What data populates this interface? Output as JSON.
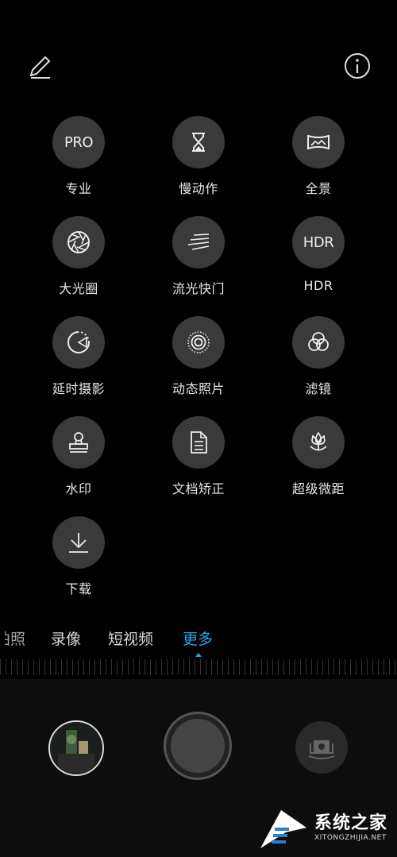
{
  "modes": [
    {
      "label": "专业",
      "icon": "pro-text-icon",
      "icon_text": "PRO"
    },
    {
      "label": "慢动作",
      "icon": "hourglass-icon"
    },
    {
      "label": "全景",
      "icon": "panorama-icon"
    },
    {
      "label": "大光圈",
      "icon": "aperture-icon"
    },
    {
      "label": "流光快门",
      "icon": "light-trail-icon"
    },
    {
      "label": "HDR",
      "icon": "hdr-text-icon",
      "icon_text": "HDR"
    },
    {
      "label": "延时摄影",
      "icon": "timelapse-icon"
    },
    {
      "label": "动态照片",
      "icon": "moving-picture-icon"
    },
    {
      "label": "滤镜",
      "icon": "filter-icon"
    },
    {
      "label": "水印",
      "icon": "stamp-icon"
    },
    {
      "label": "文档矫正",
      "icon": "document-icon"
    },
    {
      "label": "超级微距",
      "icon": "flower-macro-icon"
    },
    {
      "label": "下载",
      "icon": "download-icon"
    }
  ],
  "tabs": [
    {
      "label": "拍照",
      "visible_text": "拍照"
    },
    {
      "label": "录像"
    },
    {
      "label": "短视频"
    },
    {
      "label": "更多",
      "active": true
    }
  ],
  "watermark": {
    "title": "系统之家",
    "url": "XITONGZHIJIA.NET"
  },
  "colors": {
    "accent": "#29a3e8",
    "icon_bg": "#3a3a3a",
    "background": "#000000"
  }
}
